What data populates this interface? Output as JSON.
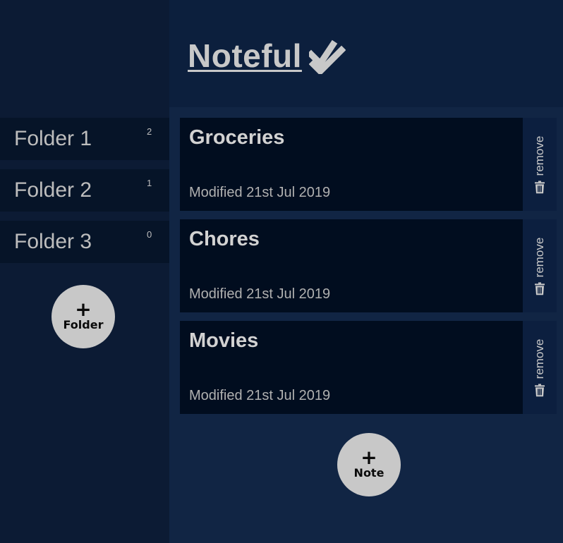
{
  "header": {
    "title": "Noteful",
    "check_icon": "double-check-icon"
  },
  "sidebar": {
    "folders": [
      {
        "name": "Folder 1",
        "count": "2"
      },
      {
        "name": "Folder 2",
        "count": "1"
      },
      {
        "name": "Folder 3",
        "count": "0"
      }
    ],
    "add_folder": {
      "plus": "+",
      "label": "Folder"
    }
  },
  "main": {
    "notes": [
      {
        "title": "Groceries",
        "modified": "Modified 21st Jul 2019",
        "remove_label": "remove",
        "remove_icon": "trash-icon"
      },
      {
        "title": "Chores",
        "modified": "Modified 21st Jul 2019",
        "remove_label": "remove",
        "remove_icon": "trash-icon"
      },
      {
        "title": "Movies",
        "modified": "Modified 21st Jul 2019",
        "remove_label": "remove",
        "remove_icon": "trash-icon"
      }
    ],
    "add_note": {
      "plus": "+",
      "label": "Note"
    }
  },
  "colors": {
    "sidebar_bg": "#0c1b34",
    "header_bg": "#0c1f3d",
    "main_bg": "#112544",
    "folder_bg": "#061428",
    "note_bg": "#010d1f",
    "remove_bg": "#0c1f3f",
    "text_light": "#c8c8c8",
    "button_bg": "#c8c8c8"
  }
}
